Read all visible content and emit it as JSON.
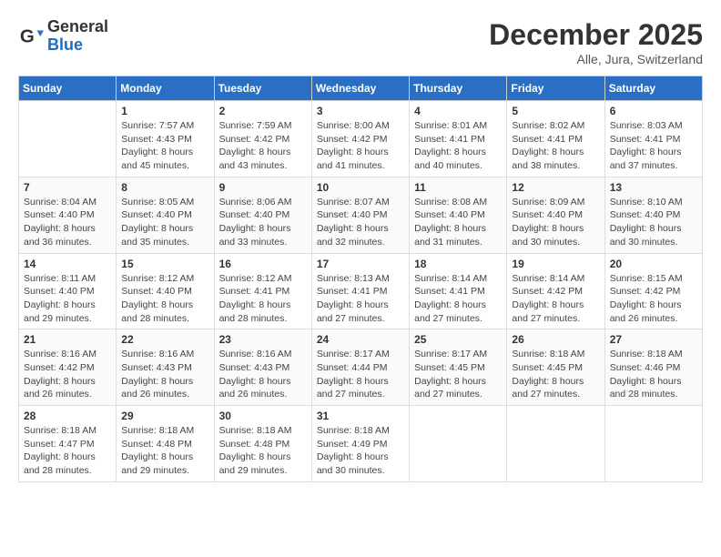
{
  "header": {
    "logo_general": "General",
    "logo_blue": "Blue",
    "month_title": "December 2025",
    "location": "Alle, Jura, Switzerland"
  },
  "weekdays": [
    "Sunday",
    "Monday",
    "Tuesday",
    "Wednesday",
    "Thursday",
    "Friday",
    "Saturday"
  ],
  "weeks": [
    [
      {
        "day": "",
        "sunrise": "",
        "sunset": "",
        "daylight": ""
      },
      {
        "day": "1",
        "sunrise": "Sunrise: 7:57 AM",
        "sunset": "Sunset: 4:43 PM",
        "daylight": "Daylight: 8 hours and 45 minutes."
      },
      {
        "day": "2",
        "sunrise": "Sunrise: 7:59 AM",
        "sunset": "Sunset: 4:42 PM",
        "daylight": "Daylight: 8 hours and 43 minutes."
      },
      {
        "day": "3",
        "sunrise": "Sunrise: 8:00 AM",
        "sunset": "Sunset: 4:42 PM",
        "daylight": "Daylight: 8 hours and 41 minutes."
      },
      {
        "day": "4",
        "sunrise": "Sunrise: 8:01 AM",
        "sunset": "Sunset: 4:41 PM",
        "daylight": "Daylight: 8 hours and 40 minutes."
      },
      {
        "day": "5",
        "sunrise": "Sunrise: 8:02 AM",
        "sunset": "Sunset: 4:41 PM",
        "daylight": "Daylight: 8 hours and 38 minutes."
      },
      {
        "day": "6",
        "sunrise": "Sunrise: 8:03 AM",
        "sunset": "Sunset: 4:41 PM",
        "daylight": "Daylight: 8 hours and 37 minutes."
      }
    ],
    [
      {
        "day": "7",
        "sunrise": "Sunrise: 8:04 AM",
        "sunset": "Sunset: 4:40 PM",
        "daylight": "Daylight: 8 hours and 36 minutes."
      },
      {
        "day": "8",
        "sunrise": "Sunrise: 8:05 AM",
        "sunset": "Sunset: 4:40 PM",
        "daylight": "Daylight: 8 hours and 35 minutes."
      },
      {
        "day": "9",
        "sunrise": "Sunrise: 8:06 AM",
        "sunset": "Sunset: 4:40 PM",
        "daylight": "Daylight: 8 hours and 33 minutes."
      },
      {
        "day": "10",
        "sunrise": "Sunrise: 8:07 AM",
        "sunset": "Sunset: 4:40 PM",
        "daylight": "Daylight: 8 hours and 32 minutes."
      },
      {
        "day": "11",
        "sunrise": "Sunrise: 8:08 AM",
        "sunset": "Sunset: 4:40 PM",
        "daylight": "Daylight: 8 hours and 31 minutes."
      },
      {
        "day": "12",
        "sunrise": "Sunrise: 8:09 AM",
        "sunset": "Sunset: 4:40 PM",
        "daylight": "Daylight: 8 hours and 30 minutes."
      },
      {
        "day": "13",
        "sunrise": "Sunrise: 8:10 AM",
        "sunset": "Sunset: 4:40 PM",
        "daylight": "Daylight: 8 hours and 30 minutes."
      }
    ],
    [
      {
        "day": "14",
        "sunrise": "Sunrise: 8:11 AM",
        "sunset": "Sunset: 4:40 PM",
        "daylight": "Daylight: 8 hours and 29 minutes."
      },
      {
        "day": "15",
        "sunrise": "Sunrise: 8:12 AM",
        "sunset": "Sunset: 4:40 PM",
        "daylight": "Daylight: 8 hours and 28 minutes."
      },
      {
        "day": "16",
        "sunrise": "Sunrise: 8:12 AM",
        "sunset": "Sunset: 4:41 PM",
        "daylight": "Daylight: 8 hours and 28 minutes."
      },
      {
        "day": "17",
        "sunrise": "Sunrise: 8:13 AM",
        "sunset": "Sunset: 4:41 PM",
        "daylight": "Daylight: 8 hours and 27 minutes."
      },
      {
        "day": "18",
        "sunrise": "Sunrise: 8:14 AM",
        "sunset": "Sunset: 4:41 PM",
        "daylight": "Daylight: 8 hours and 27 minutes."
      },
      {
        "day": "19",
        "sunrise": "Sunrise: 8:14 AM",
        "sunset": "Sunset: 4:42 PM",
        "daylight": "Daylight: 8 hours and 27 minutes."
      },
      {
        "day": "20",
        "sunrise": "Sunrise: 8:15 AM",
        "sunset": "Sunset: 4:42 PM",
        "daylight": "Daylight: 8 hours and 26 minutes."
      }
    ],
    [
      {
        "day": "21",
        "sunrise": "Sunrise: 8:16 AM",
        "sunset": "Sunset: 4:42 PM",
        "daylight": "Daylight: 8 hours and 26 minutes."
      },
      {
        "day": "22",
        "sunrise": "Sunrise: 8:16 AM",
        "sunset": "Sunset: 4:43 PM",
        "daylight": "Daylight: 8 hours and 26 minutes."
      },
      {
        "day": "23",
        "sunrise": "Sunrise: 8:16 AM",
        "sunset": "Sunset: 4:43 PM",
        "daylight": "Daylight: 8 hours and 26 minutes."
      },
      {
        "day": "24",
        "sunrise": "Sunrise: 8:17 AM",
        "sunset": "Sunset: 4:44 PM",
        "daylight": "Daylight: 8 hours and 27 minutes."
      },
      {
        "day": "25",
        "sunrise": "Sunrise: 8:17 AM",
        "sunset": "Sunset: 4:45 PM",
        "daylight": "Daylight: 8 hours and 27 minutes."
      },
      {
        "day": "26",
        "sunrise": "Sunrise: 8:18 AM",
        "sunset": "Sunset: 4:45 PM",
        "daylight": "Daylight: 8 hours and 27 minutes."
      },
      {
        "day": "27",
        "sunrise": "Sunrise: 8:18 AM",
        "sunset": "Sunset: 4:46 PM",
        "daylight": "Daylight: 8 hours and 28 minutes."
      }
    ],
    [
      {
        "day": "28",
        "sunrise": "Sunrise: 8:18 AM",
        "sunset": "Sunset: 4:47 PM",
        "daylight": "Daylight: 8 hours and 28 minutes."
      },
      {
        "day": "29",
        "sunrise": "Sunrise: 8:18 AM",
        "sunset": "Sunset: 4:48 PM",
        "daylight": "Daylight: 8 hours and 29 minutes."
      },
      {
        "day": "30",
        "sunrise": "Sunrise: 8:18 AM",
        "sunset": "Sunset: 4:48 PM",
        "daylight": "Daylight: 8 hours and 29 minutes."
      },
      {
        "day": "31",
        "sunrise": "Sunrise: 8:18 AM",
        "sunset": "Sunset: 4:49 PM",
        "daylight": "Daylight: 8 hours and 30 minutes."
      },
      {
        "day": "",
        "sunrise": "",
        "sunset": "",
        "daylight": ""
      },
      {
        "day": "",
        "sunrise": "",
        "sunset": "",
        "daylight": ""
      },
      {
        "day": "",
        "sunrise": "",
        "sunset": "",
        "daylight": ""
      }
    ]
  ]
}
